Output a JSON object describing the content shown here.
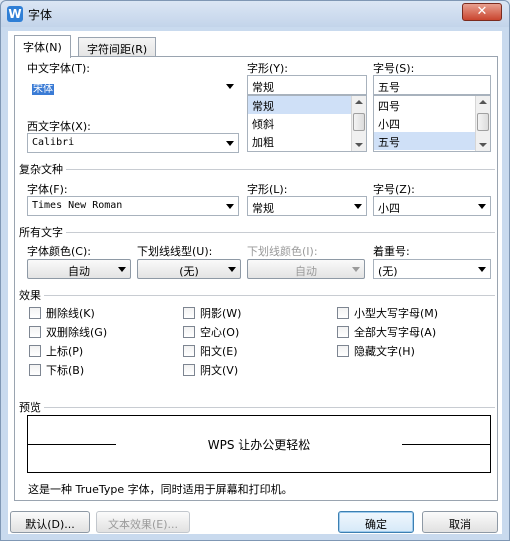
{
  "window": {
    "title": "字体",
    "app_icon_letter": "W",
    "close_glyph": "✕"
  },
  "tabs": [
    {
      "label": "字体(N)",
      "active": true
    },
    {
      "label": "字符间距(R)",
      "active": false
    }
  ],
  "chinese_font": {
    "label": "中文字体(T):",
    "value": "宋体"
  },
  "western_font": {
    "label": "西文字体(X):",
    "value": "Calibri"
  },
  "style": {
    "label": "字形(Y):",
    "value": "常规",
    "items": [
      "常规",
      "倾斜",
      "加粗"
    ],
    "selected_index": 0
  },
  "size": {
    "label": "字号(S):",
    "value": "五号",
    "items": [
      "四号",
      "小四",
      "五号"
    ],
    "selected_index": 2
  },
  "complex": {
    "section": "复杂文种",
    "font_label": "字体(F):",
    "font_value": "Times New Roman",
    "style_label": "字形(L):",
    "style_value": "常规",
    "size_label": "字号(Z):",
    "size_value": "小四"
  },
  "all_text": {
    "section": "所有文字",
    "color_label": "字体颜色(C):",
    "color_value": "自动",
    "underline_label": "下划线线型(U):",
    "underline_value": "(无)",
    "underline_color_label": "下划线颜色(I):",
    "underline_color_value": "自动",
    "emphasis_label": "着重号:",
    "emphasis_value": "(无)"
  },
  "effects": {
    "section": "效果",
    "col1": [
      "删除线(K)",
      "双删除线(G)",
      "上标(P)",
      "下标(B)"
    ],
    "col2": [
      "阴影(W)",
      "空心(O)",
      "阳文(E)",
      "阴文(V)"
    ],
    "col3": [
      "小型大写字母(M)",
      "全部大写字母(A)",
      "隐藏文字(H)"
    ]
  },
  "preview": {
    "section": "预览",
    "sample": "WPS 让办公更轻松",
    "description": "这是一种 TrueType 字体，同时适用于屏幕和打印机。"
  },
  "buttons": {
    "default": "默认(D)...",
    "text_effect": "文本效果(E)...",
    "ok": "确定",
    "cancel": "取消"
  }
}
